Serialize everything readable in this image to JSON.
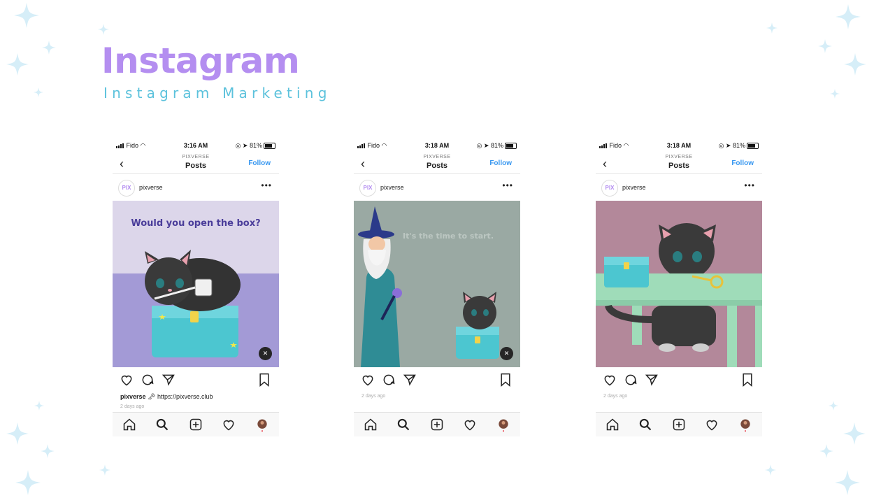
{
  "header": {
    "title": "Instagram",
    "subtitle": "Instagram Marketing"
  },
  "colors": {
    "title": "#b48ef0",
    "subtitle": "#5cc2dc",
    "follow": "#3897f0",
    "sparkle": "#d6eef8"
  },
  "phones": [
    {
      "status": {
        "carrier": "Fido",
        "time": "3:16 AM",
        "battery": "81%"
      },
      "nav": {
        "brand": "PIXVERSE",
        "title": "Posts",
        "follow": "Follow"
      },
      "post": {
        "avatar_text": "PIX",
        "username": "pixverse",
        "image_text": "Would you open the box?",
        "caption_user": "pixverse",
        "caption_text": "https://pixverse.club",
        "ago": "2 days ago"
      }
    },
    {
      "status": {
        "carrier": "Fido",
        "time": "3:18 AM",
        "battery": "81%"
      },
      "nav": {
        "brand": "PIXVERSE",
        "title": "Posts",
        "follow": "Follow"
      },
      "post": {
        "avatar_text": "PIX",
        "username": "pixverse",
        "image_text": "It's the time to start.",
        "ago": "2 days ago"
      }
    },
    {
      "status": {
        "carrier": "Fido",
        "time": "3:18 AM",
        "battery": "81%"
      },
      "nav": {
        "brand": "PIXVERSE",
        "title": "Posts",
        "follow": "Follow"
      },
      "post": {
        "avatar_text": "PIX",
        "username": "pixverse",
        "ago": "2 days ago"
      }
    }
  ]
}
